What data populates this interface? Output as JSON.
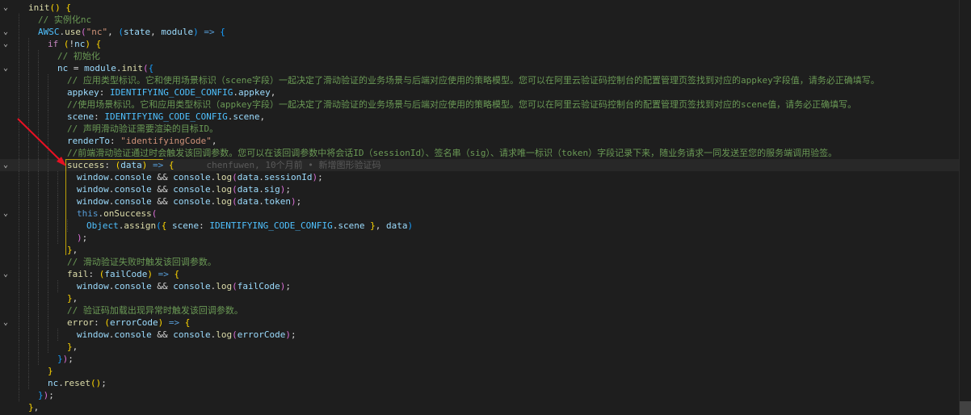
{
  "editor": {
    "blame": "chenfuwen, 10个月前 • 新增图形验证码",
    "lines": [
      {
        "fold": "v",
        "indent": 1,
        "tokens": [
          [
            "fn",
            "init"
          ],
          [
            "b1",
            "()"
          ],
          [
            "t",
            " "
          ],
          [
            "b1",
            "{"
          ]
        ]
      },
      {
        "fold": "",
        "indent": 2,
        "tokens": [
          [
            "cmt",
            "// 实例化nc"
          ]
        ]
      },
      {
        "fold": "v",
        "indent": 2,
        "tokens": [
          [
            "const",
            "AWSC"
          ],
          [
            "t",
            "."
          ],
          [
            "fn",
            "use"
          ],
          [
            "b2",
            "("
          ],
          [
            "str",
            "\"nc\""
          ],
          [
            "t",
            ", "
          ],
          [
            "b3",
            "("
          ],
          [
            "var",
            "state"
          ],
          [
            "t",
            ", "
          ],
          [
            "var",
            "module"
          ],
          [
            "b3",
            ")"
          ],
          [
            "t",
            " "
          ],
          [
            "kw",
            "=>"
          ],
          [
            "t",
            " "
          ],
          [
            "b3",
            "{"
          ]
        ]
      },
      {
        "fold": "v",
        "indent": 3,
        "tokens": [
          [
            "ctrl",
            "if"
          ],
          [
            "t",
            " "
          ],
          [
            "b1",
            "("
          ],
          [
            "t",
            "!"
          ],
          [
            "var",
            "nc"
          ],
          [
            "b1",
            ")"
          ],
          [
            "t",
            " "
          ],
          [
            "b1",
            "{"
          ]
        ]
      },
      {
        "fold": "",
        "indent": 4,
        "tokens": [
          [
            "cmt",
            "// 初始化"
          ]
        ]
      },
      {
        "fold": "v",
        "indent": 4,
        "tokens": [
          [
            "var",
            "nc"
          ],
          [
            "t",
            " = "
          ],
          [
            "var",
            "module"
          ],
          [
            "t",
            "."
          ],
          [
            "fn",
            "init"
          ],
          [
            "b2",
            "("
          ],
          [
            "b3",
            "{"
          ]
        ]
      },
      {
        "fold": "",
        "indent": 5,
        "tokens": [
          [
            "cmt",
            "// 应用类型标识。它和使用场景标识（scene字段）一起决定了滑动验证的业务场景与后端对应使用的策略模型。您可以在阿里云验证码控制台的配置管理页签找到对应的appkey字段值，请务必正确填写。"
          ]
        ]
      },
      {
        "fold": "",
        "indent": 5,
        "tokens": [
          [
            "prop",
            "appkey"
          ],
          [
            "t",
            ": "
          ],
          [
            "const",
            "IDENTIFYING_CODE_CONFIG"
          ],
          [
            "t",
            "."
          ],
          [
            "prop",
            "appkey"
          ],
          [
            "t",
            ","
          ]
        ]
      },
      {
        "fold": "",
        "indent": 5,
        "tokens": [
          [
            "cmt",
            "//使用场景标识。它和应用类型标识（appkey字段）一起决定了滑动验证的业务场景与后端对应使用的策略模型。您可以在阿里云验证码控制台的配置管理页签找到对应的scene值，请务必正确填写。"
          ]
        ]
      },
      {
        "fold": "",
        "indent": 5,
        "tokens": [
          [
            "prop",
            "scene"
          ],
          [
            "t",
            ": "
          ],
          [
            "const",
            "IDENTIFYING_CODE_CONFIG"
          ],
          [
            "t",
            "."
          ],
          [
            "prop",
            "scene"
          ],
          [
            "t",
            ","
          ]
        ]
      },
      {
        "fold": "",
        "indent": 5,
        "tokens": [
          [
            "cmt",
            "// 声明滑动验证需要渲染的目标ID。"
          ]
        ]
      },
      {
        "fold": "",
        "indent": 5,
        "tokens": [
          [
            "prop",
            "renderTo"
          ],
          [
            "t",
            ": "
          ],
          [
            "str",
            "\"identifyingCode\""
          ],
          [
            "t",
            ","
          ]
        ]
      },
      {
        "fold": "",
        "indent": 5,
        "tokens": [
          [
            "cmt",
            "//前端滑动验证通过时会触发该回调参数。您可以在该回调参数中将会话ID（sessionId）、签名串（sig）、请求唯一标识（token）字段记录下来，随业务请求一同发送至您的服务端调用验签。"
          ]
        ]
      },
      {
        "fold": "v",
        "indent": 5,
        "current": true,
        "blame": true,
        "tokens": [
          [
            "fn",
            "success"
          ],
          [
            "t",
            ": "
          ],
          [
            "b1",
            "("
          ],
          [
            "var",
            "data"
          ],
          [
            "b1",
            ")"
          ],
          [
            "t",
            " "
          ],
          [
            "kw",
            "=>"
          ],
          [
            "t",
            " "
          ],
          [
            "b1",
            "{"
          ]
        ]
      },
      {
        "fold": "",
        "indent": 6,
        "tokens": [
          [
            "var",
            "window"
          ],
          [
            "t",
            "."
          ],
          [
            "var",
            "console"
          ],
          [
            "t",
            " && "
          ],
          [
            "var",
            "console"
          ],
          [
            "t",
            "."
          ],
          [
            "fn",
            "log"
          ],
          [
            "b2",
            "("
          ],
          [
            "var",
            "data"
          ],
          [
            "t",
            "."
          ],
          [
            "prop",
            "sessionId"
          ],
          [
            "b2",
            ")"
          ],
          [
            "t",
            ";"
          ]
        ]
      },
      {
        "fold": "",
        "indent": 6,
        "tokens": [
          [
            "var",
            "window"
          ],
          [
            "t",
            "."
          ],
          [
            "var",
            "console"
          ],
          [
            "t",
            " && "
          ],
          [
            "var",
            "console"
          ],
          [
            "t",
            "."
          ],
          [
            "fn",
            "log"
          ],
          [
            "b2",
            "("
          ],
          [
            "var",
            "data"
          ],
          [
            "t",
            "."
          ],
          [
            "prop",
            "sig"
          ],
          [
            "b2",
            ")"
          ],
          [
            "t",
            ";"
          ]
        ]
      },
      {
        "fold": "",
        "indent": 6,
        "tokens": [
          [
            "var",
            "window"
          ],
          [
            "t",
            "."
          ],
          [
            "var",
            "console"
          ],
          [
            "t",
            " && "
          ],
          [
            "var",
            "console"
          ],
          [
            "t",
            "."
          ],
          [
            "fn",
            "log"
          ],
          [
            "b2",
            "("
          ],
          [
            "var",
            "data"
          ],
          [
            "t",
            "."
          ],
          [
            "prop",
            "token"
          ],
          [
            "b2",
            ")"
          ],
          [
            "t",
            ";"
          ]
        ]
      },
      {
        "fold": "v",
        "indent": 6,
        "tokens": [
          [
            "kw",
            "this"
          ],
          [
            "t",
            "."
          ],
          [
            "fn",
            "onSuccess"
          ],
          [
            "b2",
            "("
          ]
        ]
      },
      {
        "fold": "",
        "indent": 7,
        "tokens": [
          [
            "const",
            "Object"
          ],
          [
            "t",
            "."
          ],
          [
            "fn",
            "assign"
          ],
          [
            "b3",
            "("
          ],
          [
            "b1",
            "{"
          ],
          [
            "t",
            " "
          ],
          [
            "prop",
            "scene"
          ],
          [
            "t",
            ": "
          ],
          [
            "const",
            "IDENTIFYING_CODE_CONFIG"
          ],
          [
            "t",
            "."
          ],
          [
            "prop",
            "scene"
          ],
          [
            "t",
            " "
          ],
          [
            "b1",
            "}"
          ],
          [
            "t",
            ", "
          ],
          [
            "var",
            "data"
          ],
          [
            "b3",
            ")"
          ]
        ]
      },
      {
        "fold": "",
        "indent": 6,
        "tokens": [
          [
            "b2",
            ")"
          ],
          [
            "t",
            ";"
          ]
        ]
      },
      {
        "fold": "",
        "indent": 5,
        "tokens": [
          [
            "b1",
            "}"
          ],
          [
            "t",
            ","
          ]
        ]
      },
      {
        "fold": "",
        "indent": 5,
        "tokens": [
          [
            "cmt",
            "// 滑动验证失败时触发该回调参数。"
          ]
        ]
      },
      {
        "fold": "v",
        "indent": 5,
        "tokens": [
          [
            "fn",
            "fail"
          ],
          [
            "t",
            ": "
          ],
          [
            "b1",
            "("
          ],
          [
            "var",
            "failCode"
          ],
          [
            "b1",
            ")"
          ],
          [
            "t",
            " "
          ],
          [
            "kw",
            "=>"
          ],
          [
            "t",
            " "
          ],
          [
            "b1",
            "{"
          ]
        ]
      },
      {
        "fold": "",
        "indent": 6,
        "tokens": [
          [
            "var",
            "window"
          ],
          [
            "t",
            "."
          ],
          [
            "var",
            "console"
          ],
          [
            "t",
            " && "
          ],
          [
            "var",
            "console"
          ],
          [
            "t",
            "."
          ],
          [
            "fn",
            "log"
          ],
          [
            "b2",
            "("
          ],
          [
            "var",
            "failCode"
          ],
          [
            "b2",
            ")"
          ],
          [
            "t",
            ";"
          ]
        ]
      },
      {
        "fold": "",
        "indent": 5,
        "tokens": [
          [
            "b1",
            "}"
          ],
          [
            "t",
            ","
          ]
        ]
      },
      {
        "fold": "",
        "indent": 5,
        "tokens": [
          [
            "cmt",
            "// 验证码加载出现异常时触发该回调参数。"
          ]
        ]
      },
      {
        "fold": "v",
        "indent": 5,
        "tokens": [
          [
            "fn",
            "error"
          ],
          [
            "t",
            ": "
          ],
          [
            "b1",
            "("
          ],
          [
            "var",
            "errorCode"
          ],
          [
            "b1",
            ")"
          ],
          [
            "t",
            " "
          ],
          [
            "kw",
            "=>"
          ],
          [
            "t",
            " "
          ],
          [
            "b1",
            "{"
          ]
        ]
      },
      {
        "fold": "",
        "indent": 6,
        "tokens": [
          [
            "var",
            "window"
          ],
          [
            "t",
            "."
          ],
          [
            "var",
            "console"
          ],
          [
            "t",
            " && "
          ],
          [
            "var",
            "console"
          ],
          [
            "t",
            "."
          ],
          [
            "fn",
            "log"
          ],
          [
            "b2",
            "("
          ],
          [
            "var",
            "errorCode"
          ],
          [
            "b2",
            ")"
          ],
          [
            "t",
            ";"
          ]
        ]
      },
      {
        "fold": "",
        "indent": 5,
        "tokens": [
          [
            "b1",
            "}"
          ],
          [
            "t",
            ","
          ]
        ]
      },
      {
        "fold": "",
        "indent": 4,
        "tokens": [
          [
            "b3",
            "}"
          ],
          [
            "b2",
            ")"
          ],
          [
            "t",
            ";"
          ]
        ]
      },
      {
        "fold": "",
        "indent": 3,
        "tokens": [
          [
            "b1",
            "}"
          ]
        ]
      },
      {
        "fold": "",
        "indent": 3,
        "tokens": [
          [
            "var",
            "nc"
          ],
          [
            "t",
            "."
          ],
          [
            "fn",
            "reset"
          ],
          [
            "b1",
            "()"
          ],
          [
            "t",
            ";"
          ]
        ]
      },
      {
        "fold": "",
        "indent": 2,
        "tokens": [
          [
            "b3",
            "}"
          ],
          [
            "b2",
            ")"
          ],
          [
            "t",
            ";"
          ]
        ]
      },
      {
        "fold": "",
        "indent": 1,
        "tokens": [
          [
            "b1",
            "}"
          ],
          [
            "t",
            ","
          ]
        ]
      }
    ]
  },
  "colors": {
    "background": "#1e1e1e",
    "current_line": "#282828",
    "annotation_arrow": "#e81123"
  }
}
